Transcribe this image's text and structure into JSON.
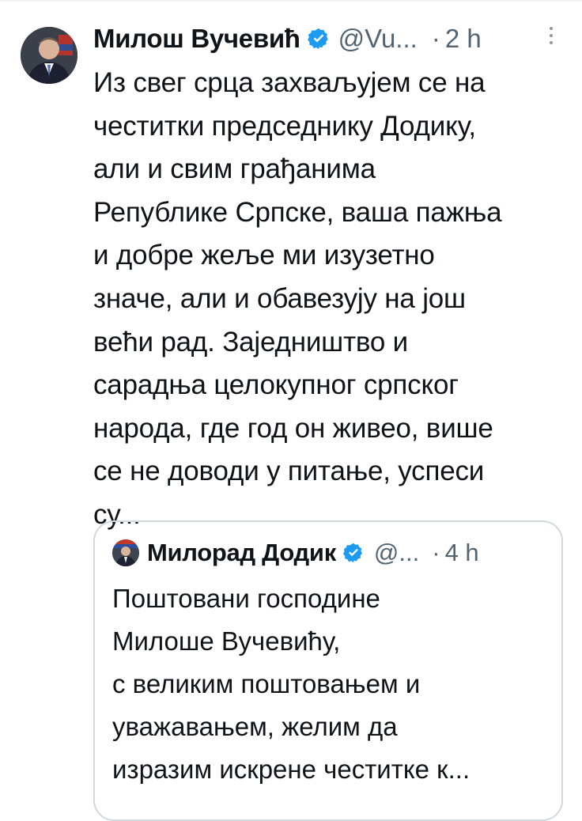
{
  "tweet": {
    "author_name": "Милош Вучевић",
    "handle": "@Vu...",
    "separator": "·",
    "time": "2 h",
    "more_icon": "more-vertical-icon",
    "verified_icon": "verified-badge-icon",
    "text_lines": [
      "Из свег срца захваљујем се на",
      "честитки председнику Додику,",
      "али и свим грађанима",
      "Републике Српске, ваша пажња",
      "и добре жеље ми изузетно",
      "значе, али и обавезују на још",
      "већи рад. Заједништво и",
      "сарадња целокупног српског",
      "народа, где год он живео, више",
      "се не доводи у питање, успеси",
      "су..."
    ]
  },
  "quoted_tweet": {
    "author_name": "Милорад Додик",
    "handle": "@...",
    "separator": "·",
    "time": "4 h",
    "text_lines": [
      "Поштовани господине",
      "Милоше Вучевићу,",
      "с великим поштовањем и",
      "уважавањем, желим да",
      "изразим искрене честитке к..."
    ]
  },
  "colors": {
    "verified": "#1d9bf0",
    "text": "#0f1419",
    "secondary": "#536471",
    "border": "#cfd9de"
  }
}
